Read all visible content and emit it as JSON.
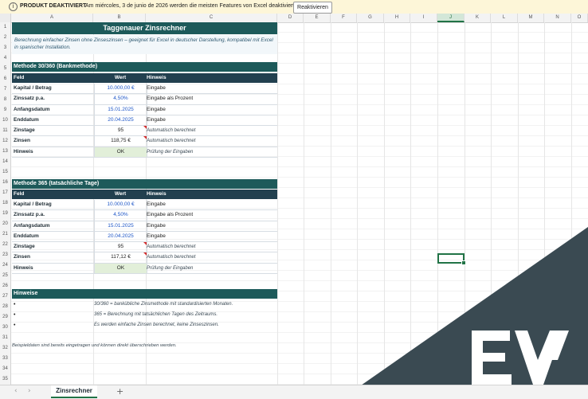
{
  "infobar": {
    "icon": "info-icon",
    "title": "PRODUKT DEAKTIVIERT",
    "message": "Am miércoles, 3 de junio de 2026 werden die meisten Features von Excel deaktiviert.",
    "button": "Reaktivieren"
  },
  "columns": [
    "A",
    "B",
    "C",
    "D",
    "E",
    "F",
    "G",
    "H",
    "I",
    "J",
    "K",
    "L",
    "M",
    "N",
    "O"
  ],
  "selected_column": "J",
  "rows": [
    "1",
    "2",
    "3",
    "4",
    "5",
    "6",
    "7",
    "8",
    "9",
    "10",
    "11",
    "12",
    "13",
    "14",
    "15",
    "16",
    "17",
    "18",
    "19",
    "20",
    "21",
    "22",
    "23",
    "24",
    "25",
    "26",
    "27",
    "28",
    "29",
    "30",
    "31",
    "32",
    "33",
    "34",
    "35"
  ],
  "sheet": {
    "title": "Taggenauer Zinsrechner",
    "description": "Berechnung einfacher Zinsen ohne Zinseszinsen – geeignet für Excel in deutscher Darstellung, kompatibel mit Excel in spanischer Installation.",
    "table_headers": {
      "feld": "Feld",
      "wert": "Wert",
      "hinweis": "Hinweis"
    },
    "method1": {
      "heading": "Methode 30/360 (Bankmethode)",
      "rows": [
        {
          "feld": "Kapital / Betrag",
          "wert": "10.000,00 €",
          "hinweis": "Eingabe",
          "kind": "input"
        },
        {
          "feld": "Zinssatz p.a.",
          "wert": "4,50%",
          "hinweis": "Eingabe als Prozent",
          "kind": "input"
        },
        {
          "feld": "Anfangsdatum",
          "wert": "15.01.2025",
          "hinweis": "Eingabe",
          "kind": "input"
        },
        {
          "feld": "Enddatum",
          "wert": "20.04.2025",
          "hinweis": "Eingabe",
          "kind": "input"
        },
        {
          "feld": "Zinstage",
          "wert": "95",
          "hinweis": "Automatisch berechnet",
          "kind": "calc"
        },
        {
          "feld": "Zinsen",
          "wert": "118,75 €",
          "hinweis": "Automatisch berechnet",
          "kind": "calc"
        },
        {
          "feld": "Hinweis",
          "wert": "OK",
          "hinweis": "Prüfung der Eingaben",
          "kind": "ok"
        }
      ]
    },
    "method2": {
      "heading": "Methode 365 (tatsächliche Tage)",
      "rows": [
        {
          "feld": "Kapital / Betrag",
          "wert": "10.000,00 €",
          "hinweis": "Eingabe",
          "kind": "input"
        },
        {
          "feld": "Zinssatz p.a.",
          "wert": "4,50%",
          "hinweis": "Eingabe als Prozent",
          "kind": "input"
        },
        {
          "feld": "Anfangsdatum",
          "wert": "15.01.2025",
          "hinweis": "Eingabe",
          "kind": "input"
        },
        {
          "feld": "Enddatum",
          "wert": "20.04.2025",
          "hinweis": "Eingabe",
          "kind": "input"
        },
        {
          "feld": "Zinstage",
          "wert": "95",
          "hinweis": "Automatisch berechnet",
          "kind": "calc"
        },
        {
          "feld": "Zinsen",
          "wert": "117,12 €",
          "hinweis": "Automatisch berechnet",
          "kind": "calc"
        },
        {
          "feld": "Hinweis",
          "wert": "OK",
          "hinweis": "Prüfung der Eingaben",
          "kind": "ok"
        }
      ]
    },
    "notes": {
      "heading": "Hinweise",
      "bullet": "•",
      "items": [
        "30/360 = bankübliche Zinsmethode mit standardisierten Monaten.",
        "365 = Berechnung mit tatsächlichen Tagen des Zeitraums.",
        "Es werden einfache Zinsen berechnet, keine Zinseszinsen."
      ]
    },
    "footnote": "Beispieldaten sind bereits eingetragen und können direkt überschrieben werden."
  },
  "tabbar": {
    "prev_icon": "chevron-left-icon",
    "next_icon": "chevron-right-icon",
    "active_tab": "Zinsrechner",
    "add_icon": "plus-icon"
  },
  "watermark": {
    "brand": "logo-watermark",
    "color": "#3a4a52"
  }
}
